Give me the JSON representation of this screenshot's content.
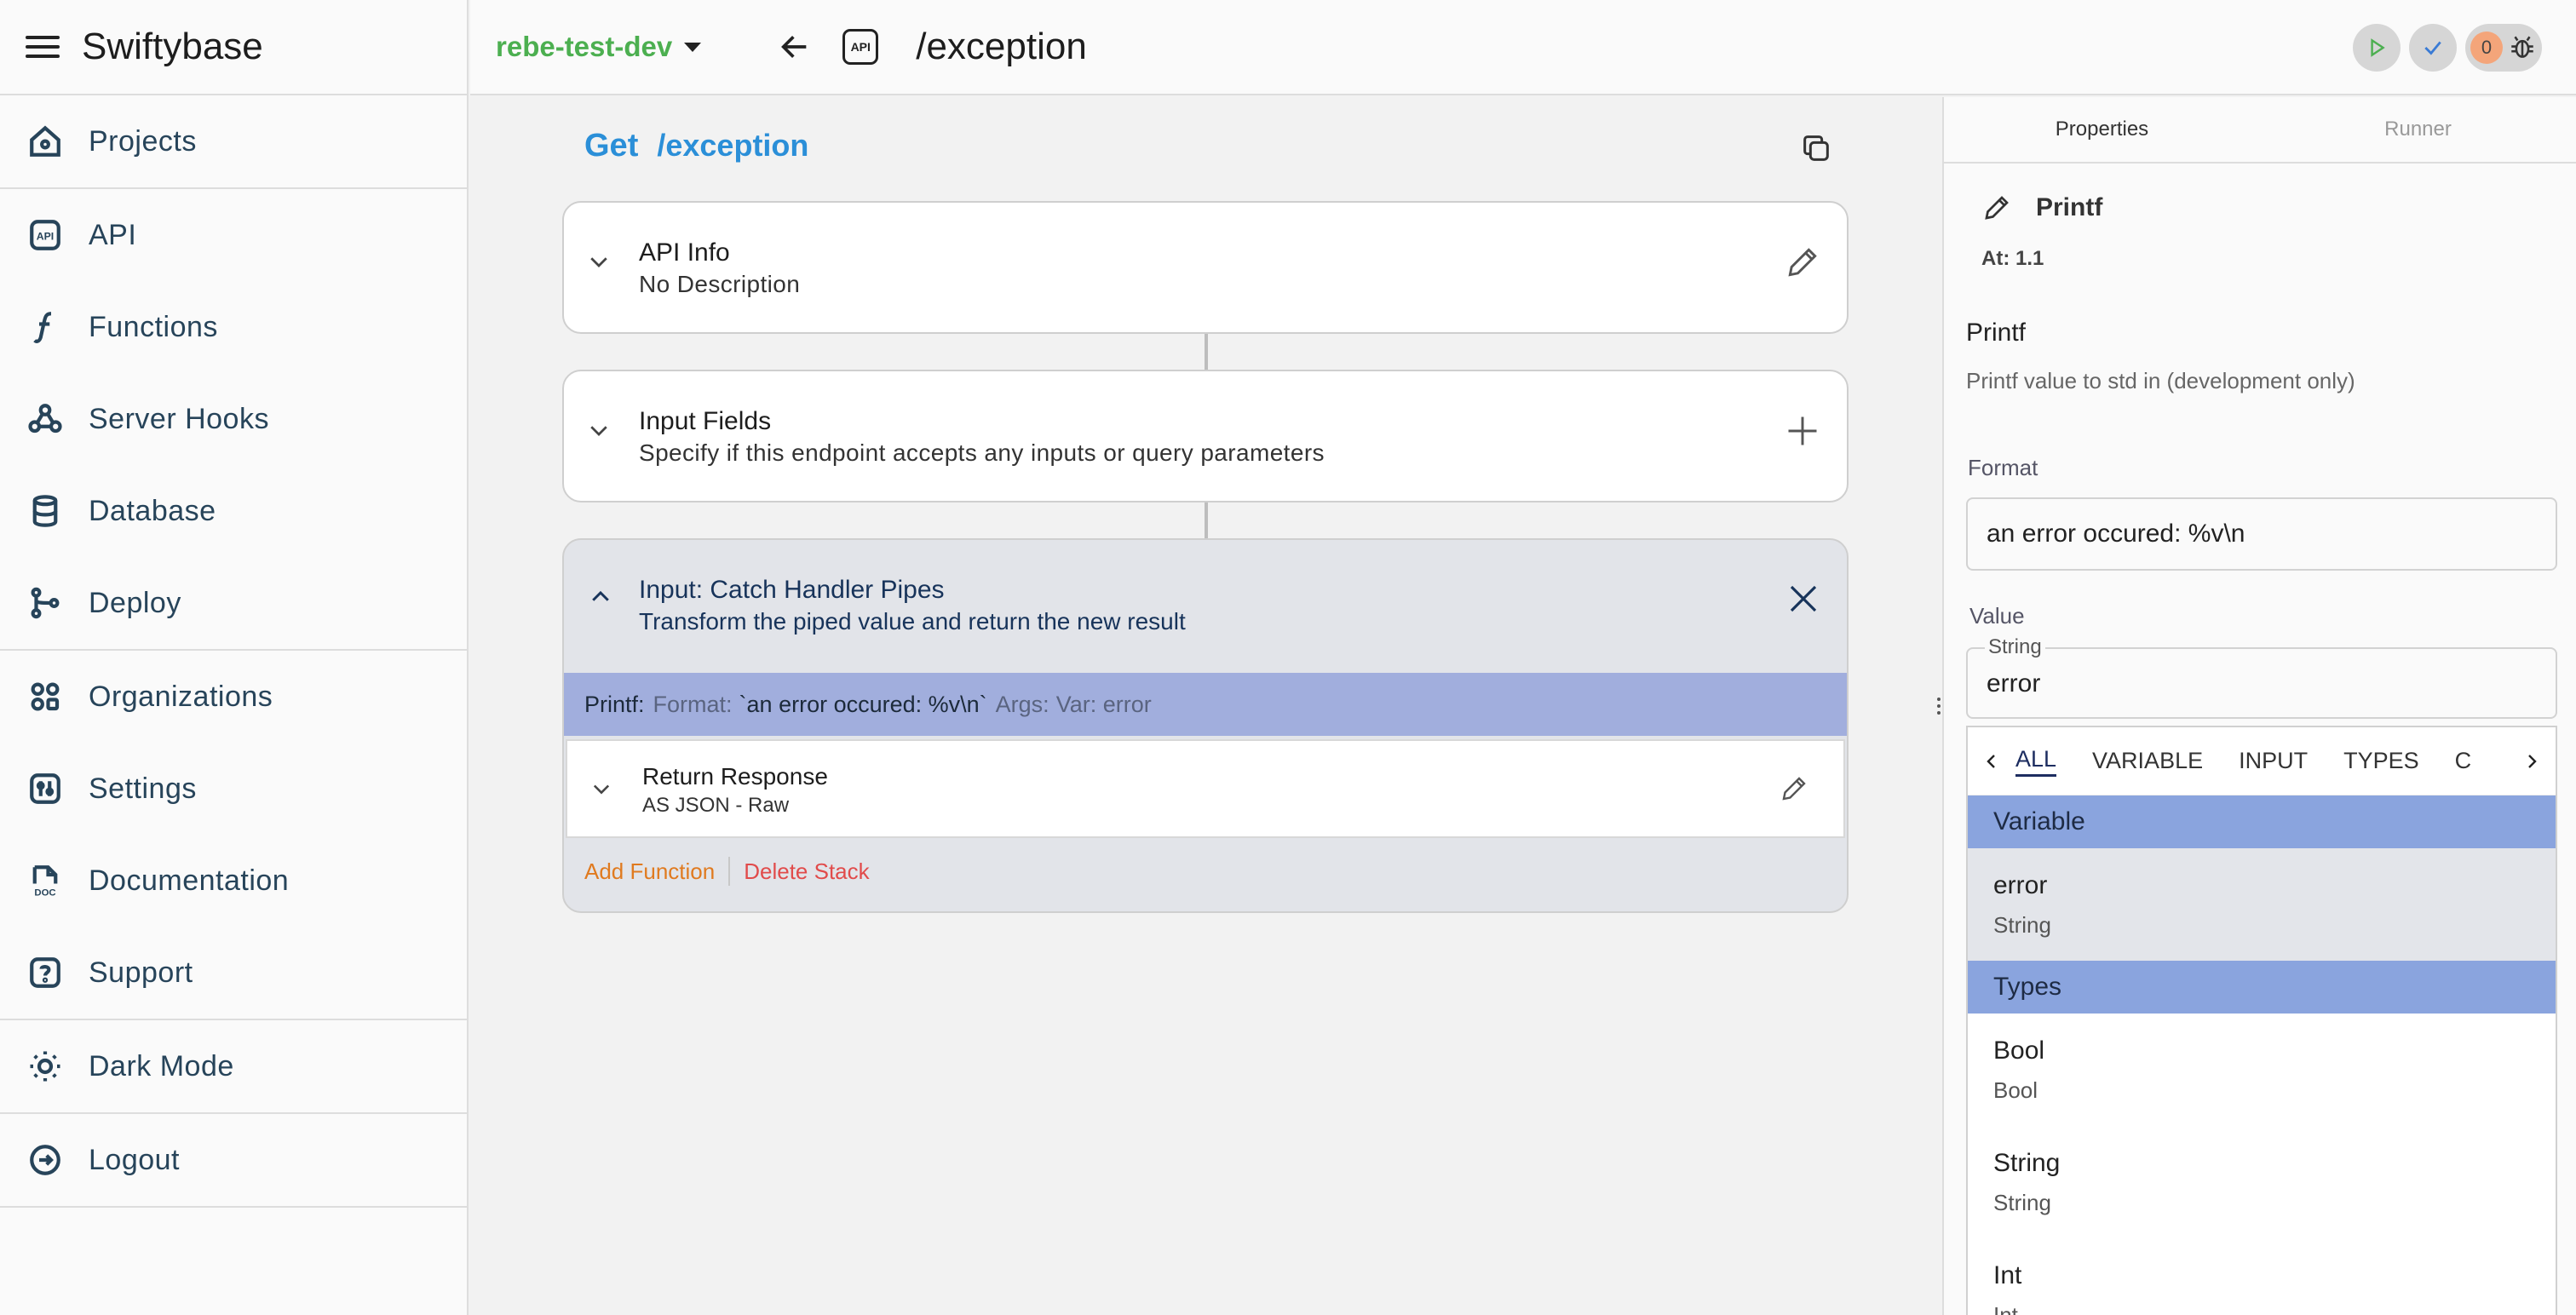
{
  "app": {
    "title": "Swiftybase"
  },
  "sidebar": {
    "groups": [
      [
        {
          "label": "Projects",
          "icon": "home-icon"
        }
      ],
      [
        {
          "label": "API",
          "icon": "api-icon"
        },
        {
          "label": "Functions",
          "icon": "function-icon"
        },
        {
          "label": "Server Hooks",
          "icon": "webhook-icon"
        },
        {
          "label": "Database",
          "icon": "database-icon"
        },
        {
          "label": "Deploy",
          "icon": "branch-icon"
        }
      ],
      [
        {
          "label": "Organizations",
          "icon": "organizations-icon"
        },
        {
          "label": "Settings",
          "icon": "settings-icon"
        },
        {
          "label": "Documentation",
          "icon": "doc-icon"
        },
        {
          "label": "Support",
          "icon": "help-icon"
        }
      ],
      [
        {
          "label": "Dark Mode",
          "icon": "sun-icon"
        }
      ],
      [
        {
          "label": "Logout",
          "icon": "logout-icon"
        }
      ]
    ]
  },
  "topbar": {
    "project": "rebe-test-dev",
    "api_badge": "API",
    "path": "/exception",
    "issue_count": "0"
  },
  "main": {
    "method": "Get",
    "path": "/exception",
    "api_info": {
      "title": "API Info",
      "subtitle": "No Description"
    },
    "input_fields": {
      "title": "Input Fields",
      "subtitle": "Specify if this endpoint accepts any inputs or query parameters"
    },
    "stack": {
      "title": "Input: Catch Handler Pipes",
      "subtitle": "Transform the piped value and return the new result",
      "printf": {
        "name": "Printf:",
        "format_label": "Format:",
        "format_value": "`an error occured: %v\\n`",
        "args_label": "Args:",
        "args_value": "Var: error"
      },
      "return_response": {
        "title": "Return Response",
        "subtitle": "AS JSON - Raw"
      },
      "add_function": "Add Function",
      "delete_stack": "Delete Stack"
    }
  },
  "panel": {
    "tabs": [
      "Properties",
      "Runner"
    ],
    "func_name": "Printf",
    "at": "At: 1.1",
    "title": "Printf",
    "description": "Printf value to std in (development only)",
    "format_label": "Format",
    "format_value": "an error occured: %v\\n",
    "value_label": "Value",
    "value_type": "String",
    "value": "error",
    "dropdown": {
      "tabs": [
        "ALL",
        "VARIABLE",
        "INPUT",
        "TYPES",
        "C"
      ],
      "sections": [
        {
          "header": "Variable",
          "items": [
            {
              "name": "error",
              "type": "String"
            }
          ]
        },
        {
          "header": "Types",
          "items": [
            {
              "name": "Bool",
              "type": "Bool"
            },
            {
              "name": "String",
              "type": "String"
            },
            {
              "name": "Int",
              "type": "Int"
            }
          ]
        }
      ]
    }
  }
}
